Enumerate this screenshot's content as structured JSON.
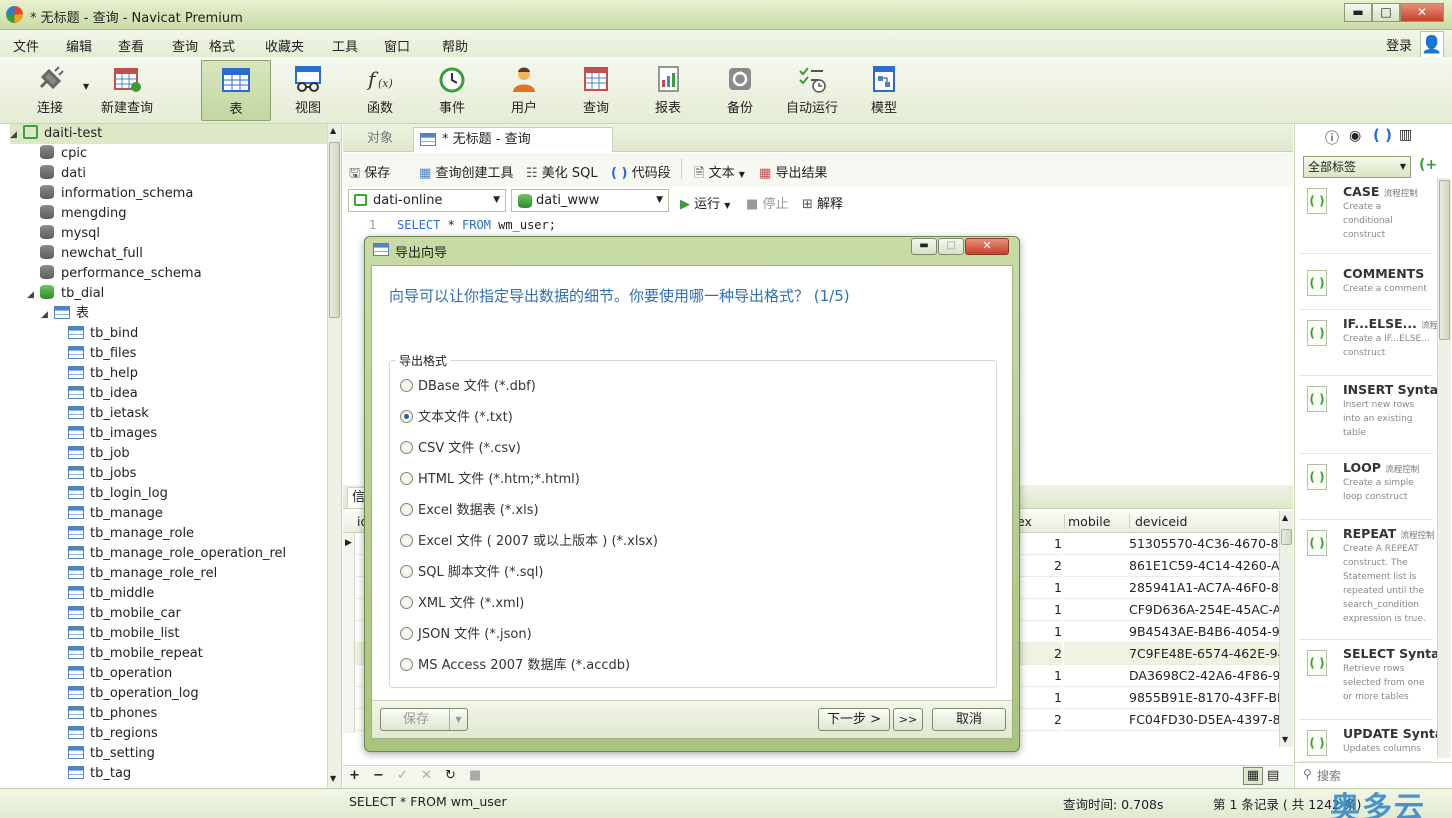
{
  "window": {
    "title": "* 无标题 - 查询 - Navicat Premium",
    "min": "▬",
    "max": "□",
    "close": "✕"
  },
  "menu": [
    "文件",
    "编辑",
    "查看",
    "查询",
    "格式",
    "收藏夹",
    "工具",
    "窗口",
    "帮助"
  ],
  "login": "登录",
  "toolbar": [
    "连接",
    "新建查询",
    "表",
    "视图",
    "函数",
    "事件",
    "用户",
    "查询",
    "报表",
    "备份",
    "自动运行",
    "模型"
  ],
  "nav": {
    "connection": "daiti-test",
    "databases": [
      "cpic",
      "dati",
      "information_schema",
      "mengding",
      "mysql",
      "newchat_full",
      "performance_schema",
      "tb_dial"
    ],
    "tables_folder": "表",
    "tables": [
      "tb_bind",
      "tb_files",
      "tb_help",
      "tb_idea",
      "tb_ietask",
      "tb_images",
      "tb_job",
      "tb_jobs",
      "tb_login_log",
      "tb_manage",
      "tb_manage_role",
      "tb_manage_role_operation_rel",
      "tb_manage_role_rel",
      "tb_middle",
      "tb_mobile_car",
      "tb_mobile_list",
      "tb_mobile_repeat",
      "tb_operation",
      "tb_operation_log",
      "tb_phones",
      "tb_regions",
      "tb_setting",
      "tb_tag"
    ]
  },
  "tabs": {
    "objects": "对象",
    "query": "* 无标题 - 查询"
  },
  "query_toolbar": {
    "save": "保存",
    "builder": "查询创建工具",
    "beautify": "美化 SQL",
    "snippet": "代码段",
    "text": "文本",
    "export": "导出结果",
    "run": "运行",
    "stop": "停止",
    "explain": "解释"
  },
  "connection_select": "dati-online",
  "database_select": "dati_www",
  "editor": {
    "line": "1",
    "sql_kw1": "SELECT",
    "sql_mid": " * ",
    "sql_kw2": "FROM",
    "sql_rest": " wm_user;"
  },
  "grid": {
    "tab_label": "信",
    "col_left": "id",
    "columns": [
      "ex",
      "mobile",
      "deviceid"
    ],
    "rows": [
      {
        "sex": "1",
        "deviceid": "51305570-4C36-4670-82"
      },
      {
        "sex": "2",
        "deviceid": "861E1C59-4C14-4260-A("
      },
      {
        "sex": "1",
        "deviceid": "285941A1-AC7A-46F0-81"
      },
      {
        "sex": "1",
        "deviceid": "CF9D636A-254E-45AC-A"
      },
      {
        "sex": "1",
        "deviceid": "9B4543AE-B4B6-4054-9"
      },
      {
        "sex": "2",
        "deviceid": "7C9FE48E-6574-462E-94"
      },
      {
        "sex": "1",
        "deviceid": "DA3698C2-42A6-4F86-9"
      },
      {
        "sex": "1",
        "deviceid": "9855B91E-8170-43FF-BE"
      },
      {
        "sex": "2",
        "deviceid": "FC04FD30-D5EA-4397-8"
      }
    ]
  },
  "status": {
    "sql": "SELECT * FROM wm_user",
    "time": "查询时间: 0.708s",
    "records": "第 1 条记录 ( 共 1242 条)"
  },
  "right_panel": {
    "tag_select": "全部标签",
    "search": "搜索",
    "snippets": [
      {
        "title": "CASE",
        "tag": "流程控制",
        "desc": "Create a conditional construct"
      },
      {
        "title": "COMMENTS",
        "tag": "",
        "desc": "Create a comment"
      },
      {
        "title": "IF...ELSE...",
        "tag": "流程控",
        "desc": "Create a IF...ELSE... construct"
      },
      {
        "title": "INSERT Syntax",
        "tag": "",
        "desc": "Insert new rows into an existing table"
      },
      {
        "title": "LOOP",
        "tag": "流程控制",
        "desc": "Create a simple loop construct"
      },
      {
        "title": "REPEAT",
        "tag": "流程控制",
        "desc": "Create A REPEAT construct. The Statement list is repeated until the search_condition expression is true."
      },
      {
        "title": "SELECT Syntax",
        "tag": "",
        "desc": "Retrieve rows selected from one or more tables"
      },
      {
        "title": "UPDATE Syntax",
        "tag": "",
        "desc": "Updates columns"
      }
    ]
  },
  "dialog": {
    "title": "导出向导",
    "heading": "向导可以让你指定导出数据的细节。你要使用哪一种导出格式？ (1/5)",
    "group": "导出格式",
    "formats": [
      "DBase 文件 (*.dbf)",
      "文本文件 (*.txt)",
      "CSV 文件 (*.csv)",
      "HTML 文件 (*.htm;*.html)",
      "Excel 数据表 (*.xls)",
      "Excel 文件 ( 2007 或以上版本 ) (*.xlsx)",
      "SQL 脚本文件 (*.sql)",
      "XML 文件 (*.xml)",
      "JSON 文件 (*.json)",
      "MS Access 2007 数据库 (*.accdb)"
    ],
    "selected_index": 1,
    "save": "保存",
    "next": "下一步 >",
    "last": ">>",
    "cancel": "取消"
  },
  "watermark": "奥多云",
  "colors": {
    "accent": "#2f6fb3",
    "theme": "#c9dba7",
    "keyword": "#2a6dcf"
  }
}
